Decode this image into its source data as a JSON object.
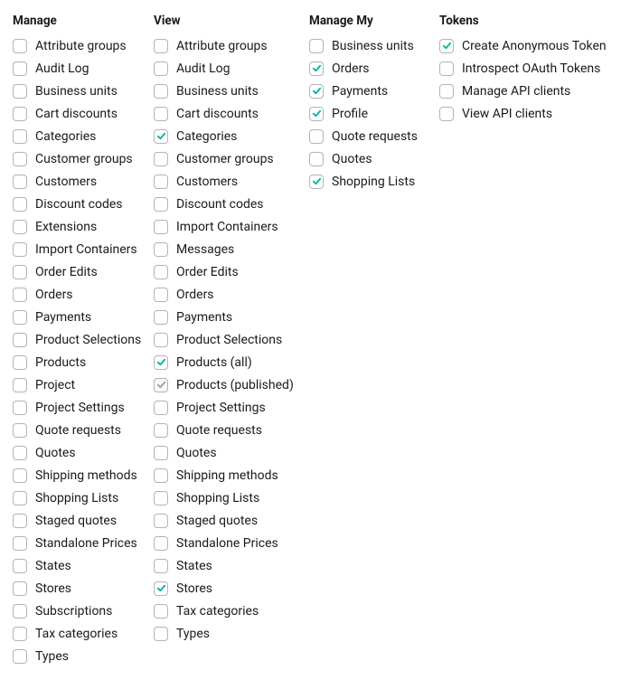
{
  "columns": [
    {
      "header": "Manage",
      "key": "manage",
      "items": [
        {
          "label": "Attribute groups",
          "checked": false,
          "disabled": false
        },
        {
          "label": "Audit Log",
          "checked": false,
          "disabled": false
        },
        {
          "label": "Business units",
          "checked": false,
          "disabled": false
        },
        {
          "label": "Cart discounts",
          "checked": false,
          "disabled": false
        },
        {
          "label": "Categories",
          "checked": false,
          "disabled": false
        },
        {
          "label": "Customer groups",
          "checked": false,
          "disabled": false
        },
        {
          "label": "Customers",
          "checked": false,
          "disabled": false
        },
        {
          "label": "Discount codes",
          "checked": false,
          "disabled": false
        },
        {
          "label": "Extensions",
          "checked": false,
          "disabled": false
        },
        {
          "label": "Import Containers",
          "checked": false,
          "disabled": false
        },
        {
          "label": "Order Edits",
          "checked": false,
          "disabled": false
        },
        {
          "label": "Orders",
          "checked": false,
          "disabled": false
        },
        {
          "label": "Payments",
          "checked": false,
          "disabled": false
        },
        {
          "label": "Product Selections",
          "checked": false,
          "disabled": false
        },
        {
          "label": "Products",
          "checked": false,
          "disabled": false
        },
        {
          "label": "Project",
          "checked": false,
          "disabled": false
        },
        {
          "label": "Project Settings",
          "checked": false,
          "disabled": false
        },
        {
          "label": "Quote requests",
          "checked": false,
          "disabled": false
        },
        {
          "label": "Quotes",
          "checked": false,
          "disabled": false
        },
        {
          "label": "Shipping methods",
          "checked": false,
          "disabled": false
        },
        {
          "label": "Shopping Lists",
          "checked": false,
          "disabled": false
        },
        {
          "label": "Staged quotes",
          "checked": false,
          "disabled": false
        },
        {
          "label": "Standalone Prices",
          "checked": false,
          "disabled": false
        },
        {
          "label": "States",
          "checked": false,
          "disabled": false
        },
        {
          "label": "Stores",
          "checked": false,
          "disabled": false
        },
        {
          "label": "Subscriptions",
          "checked": false,
          "disabled": false
        },
        {
          "label": "Tax categories",
          "checked": false,
          "disabled": false
        },
        {
          "label": "Types",
          "checked": false,
          "disabled": false
        }
      ]
    },
    {
      "header": "View",
      "key": "view",
      "items": [
        {
          "label": "Attribute groups",
          "checked": false,
          "disabled": false
        },
        {
          "label": "Audit Log",
          "checked": false,
          "disabled": false
        },
        {
          "label": "Business units",
          "checked": false,
          "disabled": false
        },
        {
          "label": "Cart discounts",
          "checked": false,
          "disabled": false
        },
        {
          "label": "Categories",
          "checked": true,
          "disabled": false
        },
        {
          "label": "Customer groups",
          "checked": false,
          "disabled": false
        },
        {
          "label": "Customers",
          "checked": false,
          "disabled": false
        },
        {
          "label": "Discount codes",
          "checked": false,
          "disabled": false
        },
        {
          "label": "Import Containers",
          "checked": false,
          "disabled": false
        },
        {
          "label": "Messages",
          "checked": false,
          "disabled": false
        },
        {
          "label": "Order Edits",
          "checked": false,
          "disabled": false
        },
        {
          "label": "Orders",
          "checked": false,
          "disabled": false
        },
        {
          "label": "Payments",
          "checked": false,
          "disabled": false
        },
        {
          "label": "Product Selections",
          "checked": false,
          "disabled": false
        },
        {
          "label": "Products (all)",
          "checked": true,
          "disabled": false
        },
        {
          "label": "Products (published)",
          "checked": true,
          "disabled": true
        },
        {
          "label": "Project Settings",
          "checked": false,
          "disabled": false
        },
        {
          "label": "Quote requests",
          "checked": false,
          "disabled": false
        },
        {
          "label": "Quotes",
          "checked": false,
          "disabled": false
        },
        {
          "label": "Shipping methods",
          "checked": false,
          "disabled": false
        },
        {
          "label": "Shopping Lists",
          "checked": false,
          "disabled": false
        },
        {
          "label": "Staged quotes",
          "checked": false,
          "disabled": false
        },
        {
          "label": "Standalone Prices",
          "checked": false,
          "disabled": false
        },
        {
          "label": "States",
          "checked": false,
          "disabled": false
        },
        {
          "label": "Stores",
          "checked": true,
          "disabled": false
        },
        {
          "label": "Tax categories",
          "checked": false,
          "disabled": false
        },
        {
          "label": "Types",
          "checked": false,
          "disabled": false
        }
      ]
    },
    {
      "header": "Manage My",
      "key": "managemy",
      "items": [
        {
          "label": "Business units",
          "checked": false,
          "disabled": false
        },
        {
          "label": "Orders",
          "checked": true,
          "disabled": false
        },
        {
          "label": "Payments",
          "checked": true,
          "disabled": false
        },
        {
          "label": "Profile",
          "checked": true,
          "disabled": false
        },
        {
          "label": "Quote requests",
          "checked": false,
          "disabled": false
        },
        {
          "label": "Quotes",
          "checked": false,
          "disabled": false
        },
        {
          "label": "Shopping Lists",
          "checked": true,
          "disabled": false
        }
      ]
    },
    {
      "header": "Tokens",
      "key": "tokens",
      "items": [
        {
          "label": "Create Anonymous Token",
          "checked": true,
          "disabled": false
        },
        {
          "label": "Introspect OAuth Tokens",
          "checked": false,
          "disabled": false
        },
        {
          "label": "Manage API clients",
          "checked": false,
          "disabled": false
        },
        {
          "label": "View API clients",
          "checked": false,
          "disabled": false
        }
      ]
    }
  ]
}
